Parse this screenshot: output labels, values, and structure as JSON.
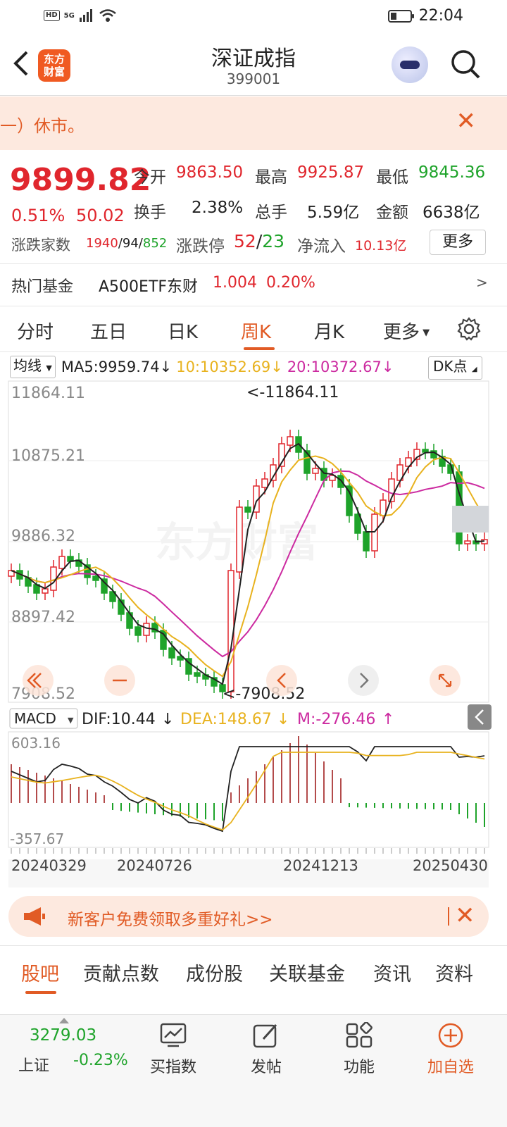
{
  "status": {
    "network": "5G",
    "hd": "HD",
    "time": "22:04"
  },
  "header": {
    "title": "深证成指",
    "code": "399001",
    "logo_text": "东方财富"
  },
  "notice": {
    "text": "一）休市。"
  },
  "quote": {
    "price": "9899.82",
    "change_pct": "0.51%",
    "change": "50.02",
    "open_label": "今开",
    "open": "9863.50",
    "high_label": "最高",
    "high": "9925.87",
    "low_label": "最低",
    "low": "9845.36",
    "turnover_label": "换手",
    "turnover": "2.38%",
    "volume_label": "总手",
    "volume": "5.59亿",
    "amount_label": "金额",
    "amount": "6638亿",
    "updown_label": "涨跌家数",
    "up": "1940",
    "flat": "94",
    "down": "852",
    "limit_label": "涨跌停",
    "limit_up": "52",
    "limit_down": "23",
    "netflow_label": "净流入",
    "netflow": "10.13亿",
    "more_button": "更多"
  },
  "hot_fund": {
    "label": "热门基金",
    "name": "A500ETF东财",
    "price": "1.004",
    "pct": "0.20%",
    "arrow": ">"
  },
  "tabs": [
    "分时",
    "五日",
    "日K",
    "周K",
    "月K",
    "更多"
  ],
  "active_tab": "周K",
  "ma_bar": {
    "select": "均线",
    "ma5": "MA5:9959.74",
    "ma10": "10:10352.69",
    "ma20": "20:10372.67",
    "dk": "DK点"
  },
  "macd_bar": {
    "select": "MACD",
    "dif": "DIF:10.44",
    "dea": "DEA:148.67",
    "m": "M:-276.46"
  },
  "chart_data": {
    "type": "candlestick",
    "price_axis_labels": [
      "11864.11",
      "10875.21",
      "9886.32",
      "8897.42",
      "7908.52"
    ],
    "high_marker": "<-11864.11",
    "low_marker": "<-7908.52",
    "macd_axis_labels": [
      "603.16",
      "-357.67"
    ],
    "date_labels": [
      "20240329",
      "20240726",
      "20241213",
      "20250430"
    ],
    "watermark": "东方财富",
    "colors": {
      "up": "#e0262d",
      "down": "#1ea32a",
      "ma5": "#222222",
      "ma10": "#e8b21e",
      "ma20": "#cc2aa0"
    }
  },
  "promo": {
    "text": "新客户免费领取多重好礼>>"
  },
  "subtabs": [
    "股吧",
    "贡献点数",
    "成份股",
    "关联基金",
    "资讯",
    "资料"
  ],
  "active_subtab": "股吧",
  "bottom": {
    "index_value": "3279.03",
    "index_name": "上证",
    "index_change": "-0.23%",
    "items": [
      "买指数",
      "发帖",
      "功能",
      "加自选"
    ]
  }
}
